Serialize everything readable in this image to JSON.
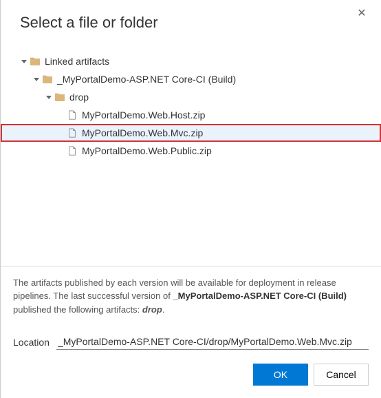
{
  "title": "Select a file or folder",
  "tree": [
    {
      "label": "Linked artifacts",
      "indent": 0,
      "type": "folder",
      "expanded": true,
      "selected": false,
      "highlighted": false
    },
    {
      "label": "_MyPortalDemo-ASP.NET Core-CI (Build)",
      "indent": 1,
      "type": "folder",
      "expanded": true,
      "selected": false,
      "highlighted": false
    },
    {
      "label": "drop",
      "indent": 2,
      "type": "folder",
      "expanded": true,
      "selected": false,
      "highlighted": false
    },
    {
      "label": "MyPortalDemo.Web.Host.zip",
      "indent": 3,
      "type": "file",
      "expanded": false,
      "selected": false,
      "highlighted": false
    },
    {
      "label": "MyPortalDemo.Web.Mvc.zip",
      "indent": 3,
      "type": "file",
      "expanded": false,
      "selected": true,
      "highlighted": true
    },
    {
      "label": "MyPortalDemo.Web.Public.zip",
      "indent": 3,
      "type": "file",
      "expanded": false,
      "selected": false,
      "highlighted": false
    }
  ],
  "info": {
    "text_before": "The artifacts published by each version will be available for deployment in release pipelines. The last successful version of ",
    "bold1": "_MyPortalDemo-ASP.NET Core-CI (Build)",
    "text_mid": " published the following artifacts: ",
    "italic1": "drop",
    "text_after": "."
  },
  "location": {
    "label": "Location",
    "value": "_MyPortalDemo-ASP.NET Core-CI/drop/MyPortalDemo.Web.Mvc.zip"
  },
  "buttons": {
    "ok": "OK",
    "cancel": "Cancel"
  }
}
